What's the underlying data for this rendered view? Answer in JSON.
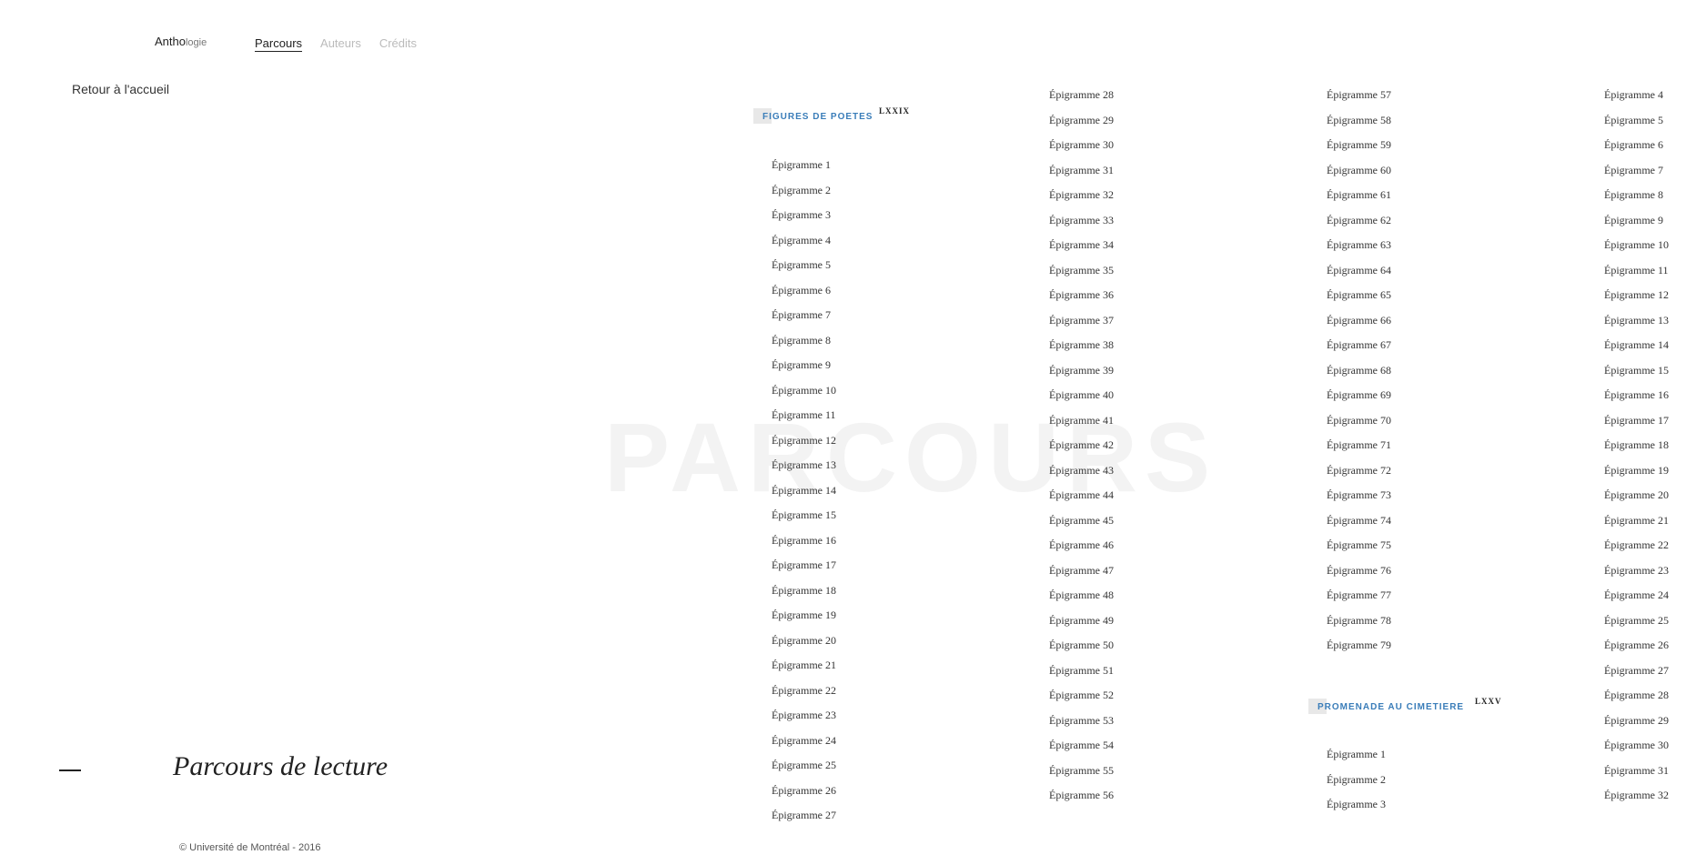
{
  "header": {
    "brand_main": "Antho",
    "brand_sub": "logie",
    "nav": [
      {
        "label": "Parcours",
        "active": true
      },
      {
        "label": "Auteurs",
        "active": false
      },
      {
        "label": "Crédits",
        "active": false
      }
    ]
  },
  "back_link": "Retour à l'accueil",
  "watermark": "PARCOURS",
  "reading_title": "Parcours de lecture",
  "footer": "© Université de Montréal - 2016",
  "sections": [
    {
      "title": "FIGURES DE POETES",
      "roman": "LXXIX"
    },
    {
      "title": "PROMENADE AU CIMETIERE",
      "roman": "LXXV"
    }
  ],
  "columns": {
    "col1": [
      "Épigramme 1",
      "Épigramme 2",
      "Épigramme 3",
      "Épigramme 4",
      "Épigramme 5",
      "Épigramme 6",
      "Épigramme 7",
      "Épigramme 8",
      "Épigramme 9",
      "Épigramme 10",
      "Épigramme 11",
      "Épigramme 12",
      "Épigramme 13",
      "Épigramme 14",
      "Épigramme 15",
      "Épigramme 16",
      "Épigramme 17",
      "Épigramme 18",
      "Épigramme 19",
      "Épigramme 20",
      "Épigramme 21",
      "Épigramme 22",
      "Épigramme 23",
      "Épigramme 24",
      "Épigramme 25",
      "Épigramme 26",
      "Épigramme 27"
    ],
    "col2": [
      "Épigramme 28",
      "Épigramme 29",
      "Épigramme 30",
      "Épigramme 31",
      "Épigramme 32",
      "Épigramme 33",
      "Épigramme 34",
      "Épigramme 35",
      "Épigramme 36",
      "Épigramme 37",
      "Épigramme 38",
      "Épigramme 39",
      "Épigramme 40",
      "Épigramme 41",
      "Épigramme 42",
      "Épigramme 43",
      "Épigramme 44",
      "Épigramme 45",
      "Épigramme 46",
      "Épigramme 47",
      "Épigramme 48",
      "Épigramme 49",
      "Épigramme 50",
      "Épigramme 51",
      "Épigramme 52",
      "Épigramme 53",
      "Épigramme 54",
      "Épigramme 55",
      "Épigramme 56"
    ],
    "col3": [
      "Épigramme 57",
      "Épigramme 58",
      "Épigramme 59",
      "Épigramme 60",
      "Épigramme 61",
      "Épigramme 62",
      "Épigramme 63",
      "Épigramme 64",
      "Épigramme 65",
      "Épigramme 66",
      "Épigramme 67",
      "Épigramme 68",
      "Épigramme 69",
      "Épigramme 70",
      "Épigramme 71",
      "Épigramme 72",
      "Épigramme 73",
      "Épigramme 74",
      "Épigramme 75",
      "Épigramme 76",
      "Épigramme 77",
      "Épigramme 78",
      "Épigramme 79"
    ],
    "col3b": [
      "Épigramme 1",
      "Épigramme 2",
      "Épigramme 3"
    ],
    "col4": [
      "Épigramme 4",
      "Épigramme 5",
      "Épigramme 6",
      "Épigramme 7",
      "Épigramme 8",
      "Épigramme 9",
      "Épigramme 10",
      "Épigramme 11",
      "Épigramme 12",
      "Épigramme 13",
      "Épigramme 14",
      "Épigramme 15",
      "Épigramme 16",
      "Épigramme 17",
      "Épigramme 18",
      "Épigramme 19",
      "Épigramme 20",
      "Épigramme 21",
      "Épigramme 22",
      "Épigramme 23",
      "Épigramme 24",
      "Épigramme 25",
      "Épigramme 26",
      "Épigramme 27",
      "Épigramme 28",
      "Épigramme 29",
      "Épigramme 30",
      "Épigramme 31",
      "Épigramme 32"
    ]
  }
}
